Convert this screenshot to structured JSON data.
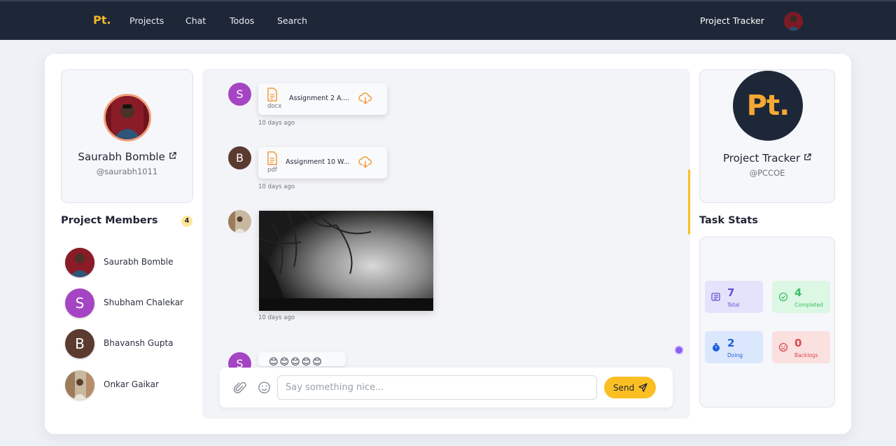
{
  "nav": {
    "brand": "Pt.",
    "links": [
      "Projects",
      "Chat",
      "Todos",
      "Search"
    ],
    "right_title": "Project Tracker"
  },
  "profile": {
    "name": "Saurabh Bomble",
    "handle": "@saurabh1011"
  },
  "members": {
    "title": "Project Members",
    "count": "4",
    "items": [
      {
        "name": "Saurabh Bomble",
        "initial": ""
      },
      {
        "name": "Shubham Chalekar",
        "initial": "S"
      },
      {
        "name": "Bhavansh Gupta",
        "initial": "B"
      },
      {
        "name": "Onkar Gaikar",
        "initial": ""
      }
    ]
  },
  "chat": {
    "messages": [
      {
        "avatar_initial": "S",
        "file_name": "Assignment 2 A....",
        "file_ext": "docx",
        "time": "10 days ago"
      },
      {
        "avatar_initial": "B",
        "file_name": "Assignment 10 W...",
        "file_ext": "pdf",
        "time": "10 days ago"
      },
      {
        "time": "10 days ago"
      },
      {
        "avatar_initial": "S",
        "emoji": "😊😊😊😊😊"
      }
    ],
    "composer": {
      "placeholder": "Say something nice...",
      "send_label": "Send"
    }
  },
  "project": {
    "logo_text": "Pt.",
    "name": "Project Tracker",
    "handle": "@PCCOE"
  },
  "stats": {
    "title": "Task Stats",
    "total": {
      "value": "7",
      "label": "Total"
    },
    "completed": {
      "value": "4",
      "label": "Completed"
    },
    "doing": {
      "value": "2",
      "label": "Doing"
    },
    "backlogs": {
      "value": "0",
      "label": "Backlogs"
    }
  },
  "colors": {
    "nav_bg": "#1e2737",
    "brand": "#f5b829",
    "accent": "#fbbf24",
    "avatar_s": "#a545c4",
    "avatar_b": "#5b3a30",
    "total_bg": "#e5e3fb",
    "completed_bg": "#dcf7e3",
    "doing_bg": "#dbe7fd",
    "backlogs_bg": "#fbe0e0"
  }
}
